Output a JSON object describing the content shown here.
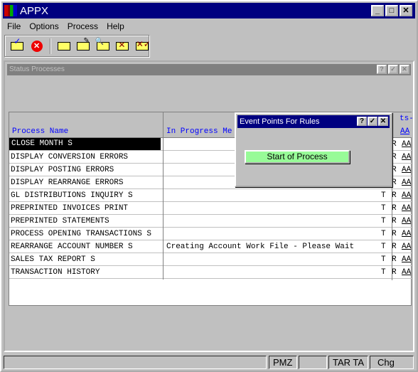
{
  "window": {
    "title": "APPX",
    "buttons": [
      "_",
      "□",
      "✕"
    ]
  },
  "menu": [
    "File",
    "Options",
    "Process",
    "Help"
  ],
  "toolbar": {
    "icons": [
      "ok-check-icon",
      "cancel-icon",
      "add-record-icon",
      "edit-record-icon",
      "inquire-record-icon",
      "delete-record-icon",
      "delete-all-icon"
    ]
  },
  "inner": {
    "title": "Status Processes",
    "buttons": [
      "?",
      "✓",
      "✕"
    ]
  },
  "table": {
    "headers": {
      "name": "Process Name",
      "message": "In Progress Me",
      "extra": "ts-",
      "aa": "AA"
    },
    "rows": [
      {
        "name": "CLOSE MONTH S",
        "message": "",
        "t": "T",
        "r": "R",
        "aa": "AA",
        "selected": true
      },
      {
        "name": "DISPLAY CONVERSION ERRORS",
        "message": "",
        "t": "T",
        "r": "R",
        "aa": "AA"
      },
      {
        "name": "DISPLAY POSTING ERRORS",
        "message": "",
        "t": "T",
        "r": "R",
        "aa": "AA"
      },
      {
        "name": "DISPLAY REARRANGE ERRORS",
        "message": "",
        "t": "T",
        "r": "R",
        "aa": "AA"
      },
      {
        "name": "GL DISTRIBUTIONS INQUIRY S",
        "message": "",
        "t": "T",
        "r": "R",
        "aa": "AA"
      },
      {
        "name": "PREPRINTED INVOICES PRINT",
        "message": "",
        "t": "T",
        "r": "R",
        "aa": "AA"
      },
      {
        "name": "PREPRINTED STATEMENTS",
        "message": "",
        "t": "T",
        "r": "R",
        "aa": "AA"
      },
      {
        "name": "PROCESS OPENING TRANSACTIONS S",
        "message": "",
        "t": "T",
        "r": "R",
        "aa": "AA"
      },
      {
        "name": "REARRANGE ACCOUNT NUMBER S",
        "message": "Creating Account Work File - Please Wait",
        "t": "T",
        "r": "R",
        "aa": "AA"
      },
      {
        "name": "SALES TAX REPORT S",
        "message": "",
        "t": "T",
        "r": "R",
        "aa": "AA"
      },
      {
        "name": "TRANSACTION HISTORY",
        "message": "",
        "t": "T",
        "r": "R",
        "aa": "AA"
      }
    ]
  },
  "dialog": {
    "title": "Event Points For Rules",
    "buttons": [
      "?",
      "✓",
      "✕"
    ],
    "start_button": "Start of Process",
    "start_color": "#98fb98"
  },
  "statusbar": [
    "",
    "PMZ",
    "",
    "TAR TA",
    "Chg"
  ]
}
